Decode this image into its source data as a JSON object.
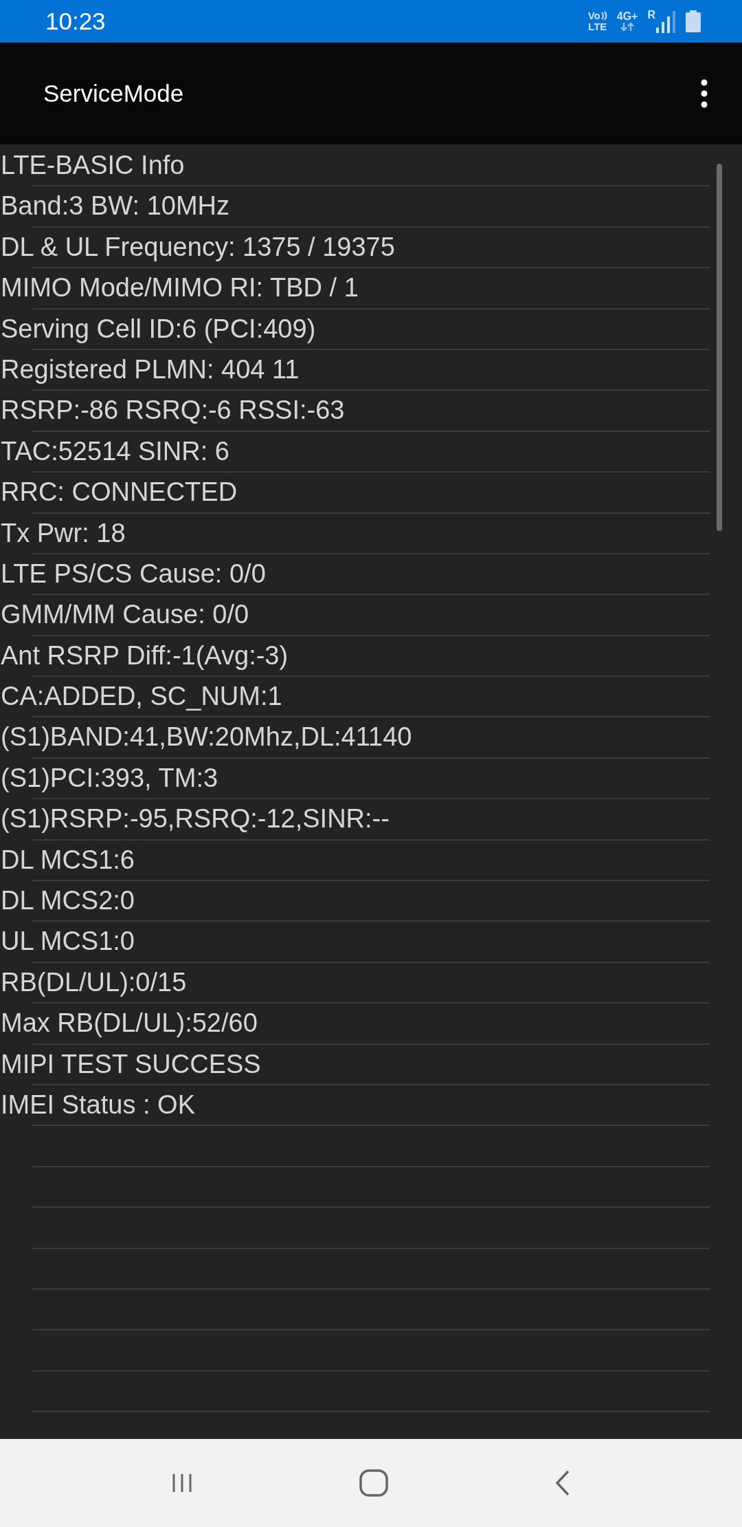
{
  "status_bar": {
    "time": "10:23",
    "volte_top": "Vo",
    "volte_bottom": "LTE",
    "network": "4G+",
    "roaming": "R"
  },
  "app_bar": {
    "title": "ServiceMode"
  },
  "rows": [
    "LTE-BASIC Info",
    "Band:3 BW: 10MHz",
    "DL & UL Frequency: 1375 / 19375",
    "MIMO Mode/MIMO RI: TBD / 1",
    "Serving Cell ID:6 (PCI:409)",
    "Registered PLMN: 404 11",
    "RSRP:-86 RSRQ:-6 RSSI:-63",
    "TAC:52514 SINR: 6",
    "RRC: CONNECTED",
    "Tx Pwr: 18",
    "LTE PS/CS Cause: 0/0",
    "GMM/MM Cause: 0/0",
    "Ant RSRP Diff:-1(Avg:-3)",
    "CA:ADDED, SC_NUM:1",
    "(S1)BAND:41,BW:20Mhz,DL:41140",
    "(S1)PCI:393, TM:3",
    "(S1)RSRP:-95,RSRQ:-12,SINR:--",
    "DL MCS1:6",
    "DL MCS2:0",
    "UL MCS1:0",
    "RB(DL/UL):0/15",
    "Max RB(DL/UL):52/60",
    "MIPI TEST SUCCESS",
    "IMEI Status : OK"
  ]
}
